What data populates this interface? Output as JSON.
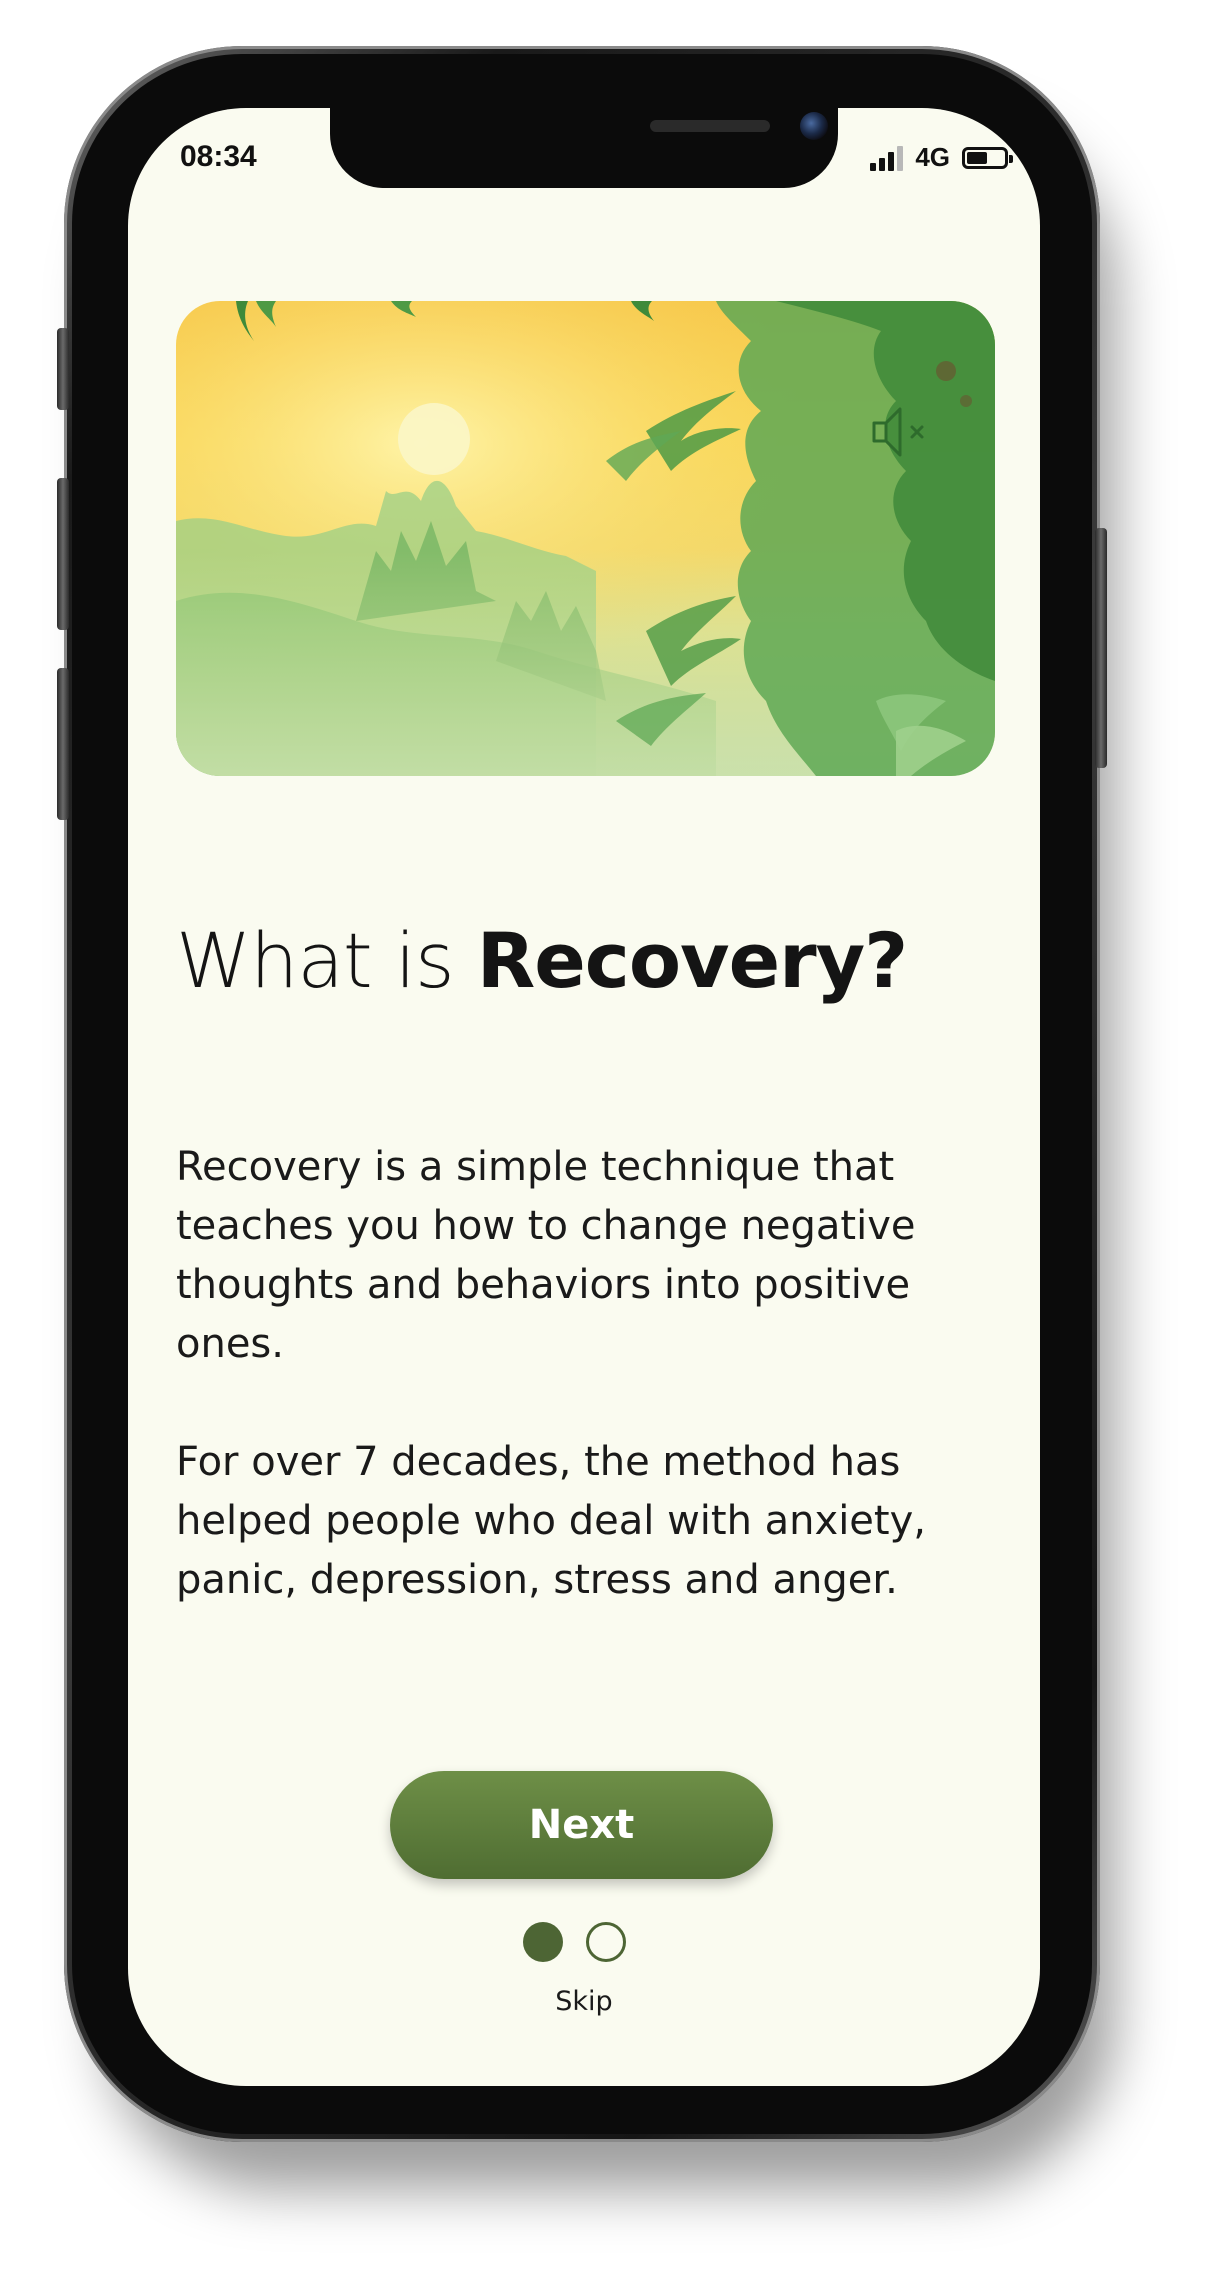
{
  "status_bar": {
    "time": "08:34",
    "network": "4G",
    "battery_level": 0.55
  },
  "hero": {
    "mute_icon": "speaker-muted-icon",
    "colors": {
      "sky_top": "#f7c84c",
      "sun": "#fbf6c4",
      "foliage_dark": "#3f8a3a",
      "foliage_mid": "#5fa855",
      "foliage_light": "#8cc77c"
    }
  },
  "title": {
    "prefix": "What is ",
    "emphasis": "Recovery?"
  },
  "body": {
    "paragraph_1": "Recovery is a simple technique that teaches you how to change negative thoughts and behaviors into positive ones.",
    "paragraph_2": "For over 7 decades, the method has helped people who deal with anxiety, panic, depression, stress and anger."
  },
  "actions": {
    "next_label": "Next",
    "skip_label": "Skip"
  },
  "pagination": {
    "total": 2,
    "current": 1
  },
  "colors": {
    "screen_background": "#fafbf0",
    "accent": "#4d6534",
    "button_gradient_top": "#6e8f47",
    "button_gradient_bottom": "#4f6d32",
    "text": "#141414"
  }
}
